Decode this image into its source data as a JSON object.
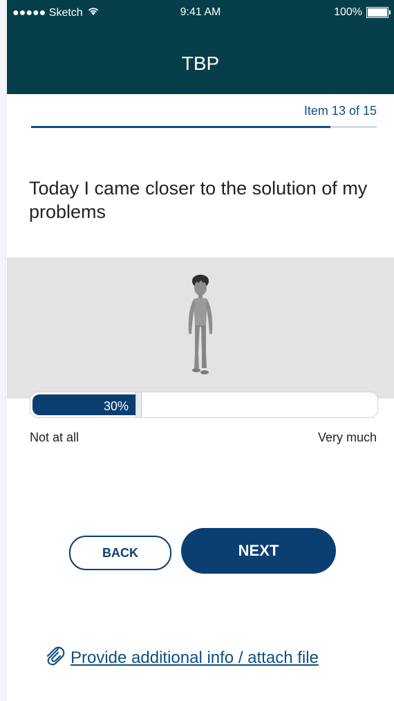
{
  "status_bar": {
    "carrier": "●●●●● Sketch",
    "time": "9:41 AM",
    "battery": "100%"
  },
  "header": {
    "title": "TBP"
  },
  "progress": {
    "label": "Item 13 of 15",
    "fraction": 0.8667
  },
  "question": {
    "text": "Today I came closer to the solution of my problems"
  },
  "slider": {
    "value_label": "30%",
    "value": 0.3,
    "min_label": "Not at all",
    "max_label": "Very much"
  },
  "buttons": {
    "back": "BACK",
    "next": "NEXT"
  },
  "attachment": {
    "label": "Provide additional info / attach file",
    "icon": "paperclip-icon"
  },
  "colors": {
    "header_bg": "#063f4a",
    "primary": "#0b3f72",
    "link": "#0f4f85",
    "figure_bg": "#e3e3e3"
  }
}
